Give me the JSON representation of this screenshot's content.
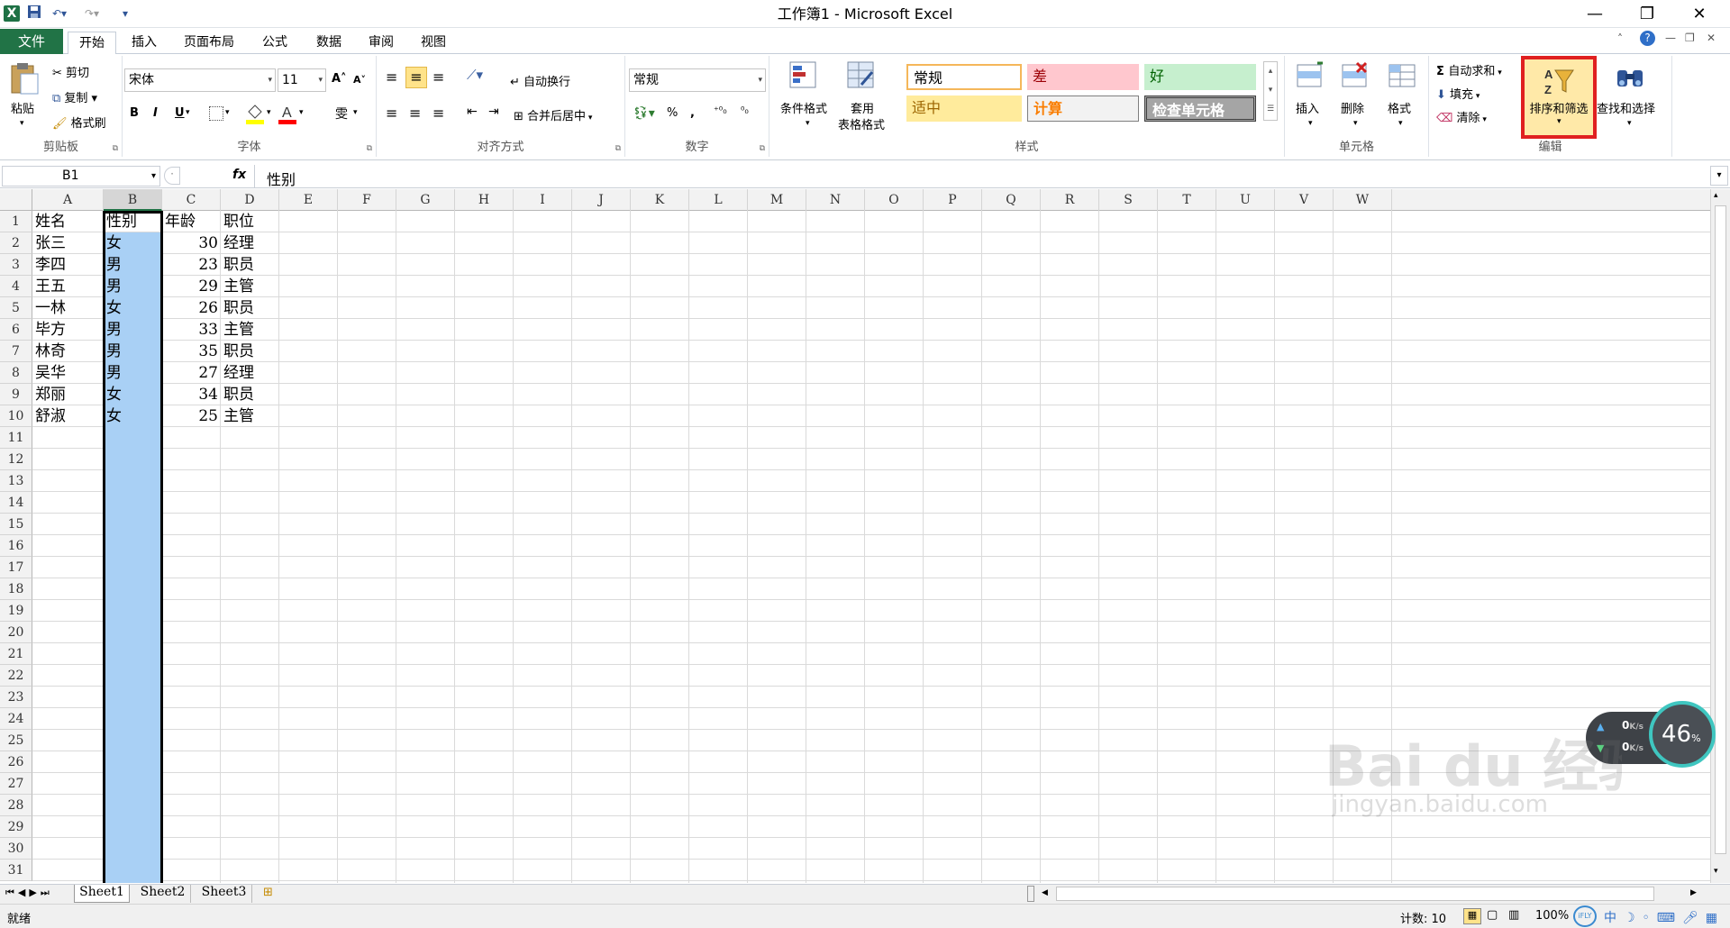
{
  "window": {
    "title": "工作簿1 - Microsoft Excel",
    "minimize": "—",
    "restore": "❐",
    "close": "✕"
  },
  "qat": {
    "save_icon": "save-icon",
    "undo": "↶▾",
    "redo": "↷▾",
    "customize": "▾"
  },
  "tabs": {
    "file": "文件",
    "items": [
      "开始",
      "插入",
      "页面布局",
      "公式",
      "数据",
      "审阅",
      "视图"
    ]
  },
  "ribbon": {
    "clipboard": {
      "label": "剪贴板",
      "paste": "粘贴",
      "cut": "剪切",
      "copy": "复制 ▾",
      "format_painter": "格式刷"
    },
    "font": {
      "label": "字体",
      "name": "宋体",
      "size": "11",
      "bold": "B",
      "italic": "I",
      "underline": "U",
      "grow": "A˄",
      "shrink": "A˅",
      "font_color": "#ff0000",
      "fill_color": "#ffff00"
    },
    "alignment": {
      "label": "对齐方式",
      "wrap": "自动换行",
      "merge": "合并后居中"
    },
    "number": {
      "label": "数字",
      "format": "常规",
      "percent": "%",
      "comma": ",",
      "inc_decimal": "⁺⁰₀",
      "dec_decimal": "⁰₀"
    },
    "styles": {
      "label": "样式",
      "conditional": "条件格式",
      "table_fmt_1": "套用",
      "table_fmt_2": "表格格式",
      "normal": "常规",
      "bad": "差",
      "good": "好",
      "neutral": "适中",
      "calc": "计算",
      "check": "检查单元格"
    },
    "cells": {
      "label": "单元格",
      "insert": "插入",
      "delete": "删除",
      "format": "格式"
    },
    "editing": {
      "label": "编辑",
      "autosum": "自动求和",
      "fill": "填充",
      "clear": "清除",
      "sort_filter": "排序和筛选",
      "find_select": "查找和选择",
      "highlight": "#e02020"
    }
  },
  "formula": {
    "name_box": "B1",
    "fx": "fx",
    "content": "性别"
  },
  "grid": {
    "columns": [
      "A",
      "B",
      "C",
      "D",
      "E",
      "F",
      "G",
      "H",
      "I",
      "J",
      "K",
      "L",
      "M",
      "N",
      "O",
      "P",
      "Q",
      "R",
      "S",
      "T",
      "U",
      "V",
      "W"
    ],
    "rows": [
      "1",
      "2",
      "3",
      "4",
      "5",
      "6",
      "7",
      "8",
      "9",
      "10",
      "11",
      "12",
      "13",
      "14",
      "15",
      "16",
      "17",
      "18",
      "19",
      "20",
      "21",
      "22",
      "23",
      "24",
      "25",
      "26",
      "27",
      "28",
      "29",
      "30",
      "31"
    ],
    "data": [
      [
        "姓名",
        "性别",
        "年龄",
        "职位"
      ],
      [
        "张三",
        "女",
        "30",
        "经理"
      ],
      [
        "李四",
        "男",
        "23",
        "职员"
      ],
      [
        "王五",
        "男",
        "29",
        "主管"
      ],
      [
        "一林",
        "女",
        "26",
        "职员"
      ],
      [
        "毕方",
        "男",
        "33",
        "主管"
      ],
      [
        "林奇",
        "男",
        "35",
        "职员"
      ],
      [
        "吴华",
        "男",
        "27",
        "经理"
      ],
      [
        "郑丽",
        "女",
        "34",
        "职员"
      ],
      [
        "舒淑",
        "女",
        "25",
        "主管"
      ]
    ],
    "selection_color": "#a9d0f5"
  },
  "sheets": [
    "Sheet1",
    "Sheet2",
    "Sheet3"
  ],
  "status": {
    "ready": "就绪",
    "count": "计数: 10",
    "zoom": "100%"
  },
  "widget": {
    "up": "0",
    "down": "0",
    "unit": "K/s",
    "percent": "46",
    "percent_sign": "%"
  },
  "watermark": {
    "brand": "Bai du 经验",
    "url": "jingyan.baidu.com"
  }
}
